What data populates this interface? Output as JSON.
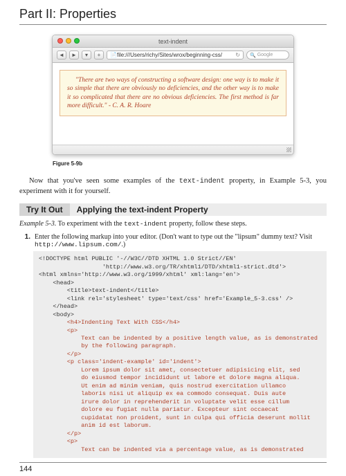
{
  "header": {
    "part_title": "Part II: Properties"
  },
  "browser": {
    "window_title": "text-indent",
    "url": "file:///Users/richy/Sites/wrox/beginning-css/",
    "search_placeholder": "Google",
    "quote": "\"There are two ways of constructing a software design: one way is to make it so simple that there are obviously no deficiencies, and the other way is to make it so complicated that there are no obvious deficiencies. The first method is far more difficult.\" - C. A. R. Hoare"
  },
  "figure_label": "Figure 5-9b",
  "intro": {
    "pre": "Now that you've seen some examples of the ",
    "code": "text-indent",
    "post": " property, in Example 5-3, you experiment with it for yourself."
  },
  "tryit": {
    "label": "Try It Out",
    "title": "Applying the text-indent Property"
  },
  "example": {
    "prefix": "Example 5-3.",
    "mid": " To experiment with the ",
    "code": "text-indent",
    "post": " property, follow these steps."
  },
  "step1": {
    "num": "1.",
    "text_a": "Enter the following markup into your editor. (Don't want to type out the \"lipsum\" dummy text? Visit ",
    "url": "http://www.lipsum.com/",
    "text_b": ".)"
  },
  "code": {
    "l01": "<!DOCTYPE html PUBLIC '-//W3C//DTD XHTML 1.0 Strict//EN'",
    "l02": "                  'http://www.w3.org/TR/xhtml1/DTD/xhtml1-strict.dtd'>",
    "l03": "<html xmlns='http://www.w3.org/1999/xhtml' xml:lang='en'>",
    "l04": "    <head>",
    "l05": "        <title>text-indent</title>",
    "l06": "        <link rel='stylesheet' type='text/css' href='Example_5-3.css' />",
    "l07": "    </head>",
    "l08": "    <body>",
    "l09": "        <h4>Indenting Text With CSS</h4>",
    "l10": "        <p>",
    "l11": "            Text can be indented by a positive length value, as is demonstrated",
    "l12": "            by the following paragraph.",
    "l13": "        </p>",
    "l14": "        <p class='indent-example' id='indent'>",
    "l15": "            Lorem ipsum dolor sit amet, consectetuer adipisicing elit, sed",
    "l16": "            do eiusmod tempor incididunt ut labore et dolore magna aliqua.",
    "l17": "            Ut enim ad minim veniam, quis nostrud exercitation ullamco",
    "l18": "            laboris nisi ut aliquip ex ea commodo consequat. Duis aute",
    "l19": "            irure dolor in reprehenderit in voluptate velit esse cillum",
    "l20": "            dolore eu fugiat nulla pariatur. Excepteur sint occaecat",
    "l21": "            cupidatat non proident, sunt in culpa qui officia deserunt mollit",
    "l22": "            anim id est laborum.",
    "l23": "        </p>",
    "l24": "        <p>",
    "l25": "            Text can be indented via a percentage value, as is demonstrated"
  },
  "page_number": "144"
}
